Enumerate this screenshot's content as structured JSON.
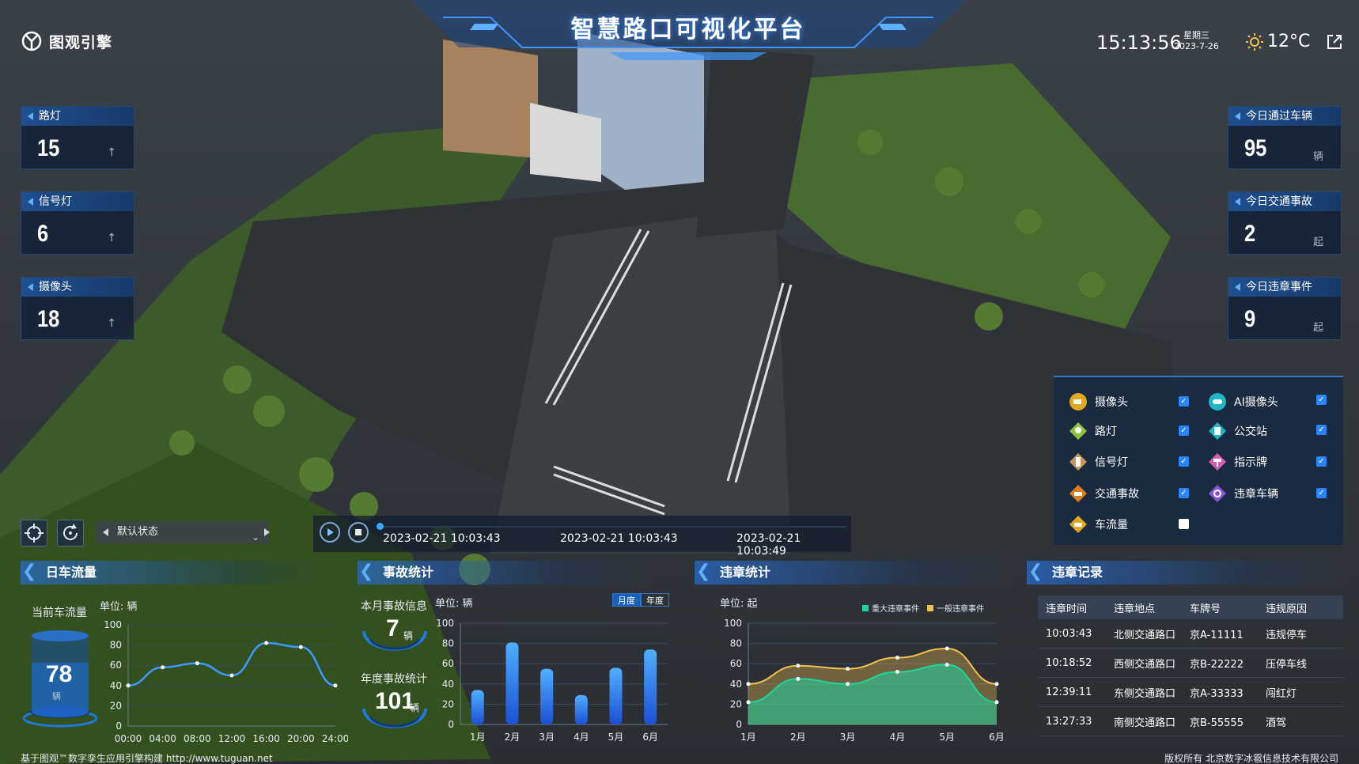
{
  "header": {
    "logo_text": "图观引擎",
    "title": "智慧路口可视化平台",
    "time": "15:13:56",
    "weekday": "星期三",
    "date": "2023-7-26",
    "temperature": "12°C",
    "weather_icon": "sun-icon",
    "export_icon": "external-link-icon"
  },
  "left_stats": [
    {
      "label": "路灯",
      "value": "15",
      "trend_icon": "arrow-up-icon",
      "trend": "↑"
    },
    {
      "label": "信号灯",
      "value": "6",
      "trend_icon": "arrow-up-icon",
      "trend": "↑"
    },
    {
      "label": "摄像头",
      "value": "18",
      "trend_icon": "arrow-up-icon",
      "trend": "↑"
    }
  ],
  "right_stats": [
    {
      "label": "今日通过车辆",
      "value": "95",
      "unit": "辆"
    },
    {
      "label": "今日交通事故",
      "value": "2",
      "unit": "起"
    },
    {
      "label": "今日违章事件",
      "value": "9",
      "unit": "起"
    }
  ],
  "layers": [
    {
      "label": "摄像头",
      "icon": "camera-icon",
      "checked": true,
      "color": "#e0a81e"
    },
    {
      "label": "AI摄像头",
      "icon": "ai-camera-icon",
      "checked": true,
      "color": "#1fb6c9"
    },
    {
      "label": "路灯",
      "icon": "street-light-icon",
      "checked": true,
      "color": "#8cc43c"
    },
    {
      "label": "公交站",
      "icon": "bus-stop-icon",
      "checked": true,
      "color": "#1fb6c9"
    },
    {
      "label": "信号灯",
      "icon": "traffic-light-icon",
      "checked": true,
      "color": "#c8955a"
    },
    {
      "label": "指示牌",
      "icon": "signpost-icon",
      "checked": true,
      "color": "#d55bb8"
    },
    {
      "label": "交通事故",
      "icon": "accident-icon",
      "checked": true,
      "color": "#e07a1e"
    },
    {
      "label": "违章车辆",
      "icon": "violation-vehicle-icon",
      "checked": true,
      "color": "#8a55d6"
    },
    {
      "label": "车流量",
      "icon": "traffic-flow-icon",
      "checked": false,
      "color": "#e0a81e"
    }
  ],
  "controls": {
    "locate_icon": "crosshair-icon",
    "reset_icon": "rotate-icon",
    "state_select": "默认状态",
    "play_icon": "play-icon",
    "stop_icon": "stop-icon",
    "timestamps": [
      "2023-02-21 10:03:43",
      "2023-02-21 10:03:43",
      "2023-02-21 10:03:49"
    ]
  },
  "daily_flow": {
    "title": "日车流量",
    "current_label": "当前车流量",
    "current_value": "78",
    "current_unit": "辆",
    "unit_label": "单位: 辆"
  },
  "accident_stats": {
    "title": "事故统计",
    "unit_label": "单位: 辆",
    "month_label": "本月事故信息",
    "month_value": "7",
    "month_unit": "辆",
    "year_label": "年度事故统计",
    "year_value": "101",
    "year_unit": "辆",
    "tabs": [
      "月度",
      "年度"
    ],
    "active_tab": "月度"
  },
  "violation_stats": {
    "title": "违章统计",
    "unit_label": "单位: 起"
  },
  "violation_records": {
    "title": "违章记录",
    "columns": [
      "违章时间",
      "违章地点",
      "车牌号",
      "违规原因"
    ],
    "rows": [
      [
        "10:03:43",
        "北侧交通路口",
        "京A-11111",
        "违规停车"
      ],
      [
        "10:18:52",
        "西侧交通路口",
        "京B-22222",
        "压停车线"
      ],
      [
        "12:39:11",
        "东侧交通路口",
        "京A-33333",
        "闯红灯"
      ],
      [
        "13:27:33",
        "南侧交通路口",
        "京B-55555",
        "酒驾"
      ]
    ]
  },
  "footer": {
    "left": "基于图观™数字孪生应用引擎构建 http://www.tuguan.net",
    "right": "版权所有 北京数字冰雹信息技术有限公司"
  },
  "colors": {
    "accent": "#2a86ff",
    "flow_line": "#3a9cff",
    "bar": "#2f78ff",
    "series_major": "#1fd6a0",
    "series_minor": "#f2c14e"
  },
  "chart_data": [
    {
      "type": "line",
      "title": "日车流量",
      "x": [
        "00:00",
        "04:00",
        "08:00",
        "12:00",
        "16:00",
        "20:00",
        "24:00"
      ],
      "series": [
        {
          "values": [
            40,
            58,
            62,
            50,
            82,
            78,
            40
          ]
        }
      ],
      "ylim": [
        0,
        100
      ],
      "yticks": [
        0,
        20,
        40,
        60,
        80,
        100
      ],
      "grid": true
    },
    {
      "type": "bar",
      "title": "事故统计",
      "categories": [
        "1月",
        "2月",
        "3月",
        "4月",
        "5月",
        "6月"
      ],
      "values": [
        34,
        81,
        55,
        29,
        56,
        74
      ],
      "ylim": [
        0,
        100
      ],
      "yticks": [
        0,
        20,
        40,
        60,
        80,
        100
      ],
      "grid": true
    },
    {
      "type": "area",
      "title": "违章统计",
      "categories": [
        "1月",
        "2月",
        "3月",
        "4月",
        "5月",
        "6月"
      ],
      "series": [
        {
          "name": "重大违章事件",
          "values": [
            22,
            45,
            40,
            52,
            59,
            22
          ]
        },
        {
          "name": "一般违章事件",
          "values": [
            40,
            58,
            55,
            66,
            75,
            40
          ]
        }
      ],
      "ylim": [
        0,
        100
      ],
      "yticks": [
        0,
        20,
        40,
        60,
        80,
        100
      ],
      "legend": "top-right",
      "grid": true
    }
  ]
}
